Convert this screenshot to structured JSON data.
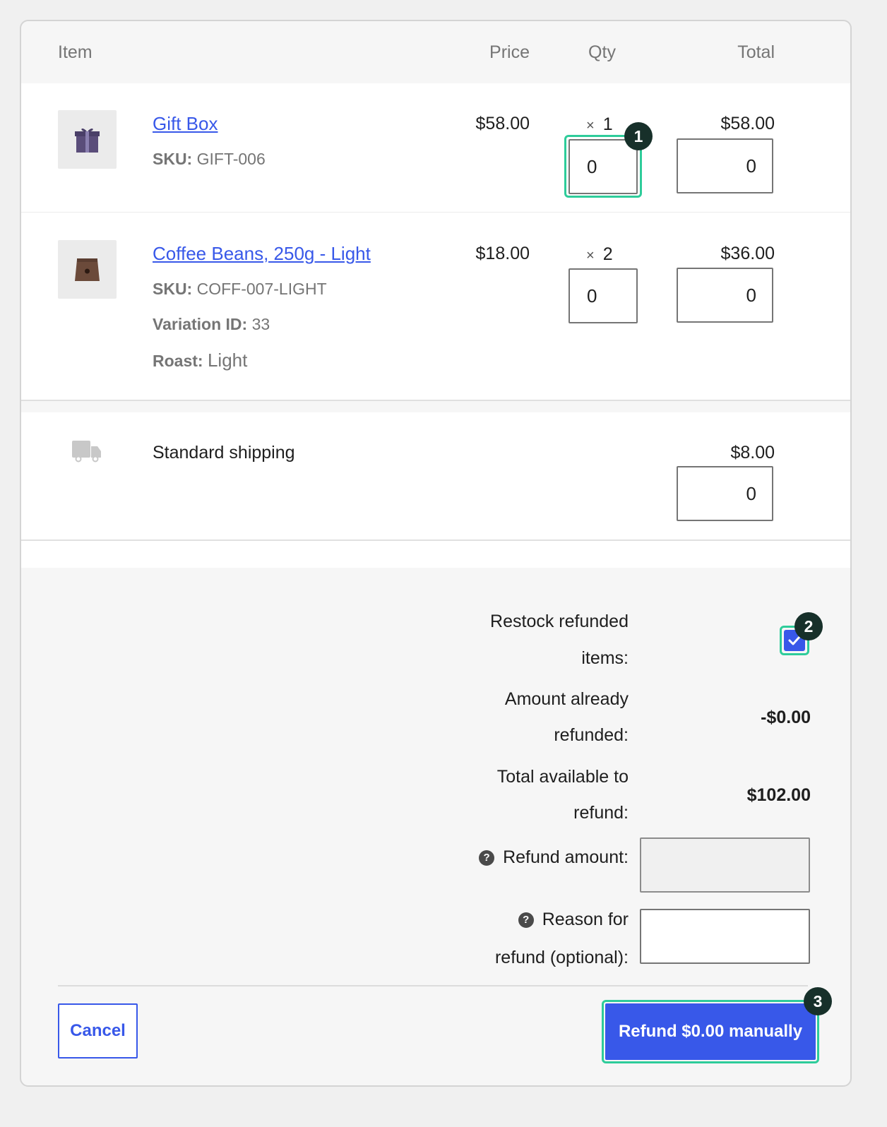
{
  "table": {
    "headers": {
      "item": "Item",
      "price": "Price",
      "qty": "Qty",
      "total": "Total"
    }
  },
  "items": [
    {
      "name": "Gift Box",
      "sku_label": "SKU:",
      "sku": "GIFT-006",
      "price": "$58.00",
      "qty_mult": "×",
      "qty": "1",
      "total": "$58.00",
      "refund_qty": "0",
      "refund_total": "0",
      "thumb_icon": "gift-box-icon"
    },
    {
      "name": "Coffee Beans, 250g - Light",
      "sku_label": "SKU:",
      "sku": "COFF-007-LIGHT",
      "variation_label": "Variation ID:",
      "variation": "33",
      "roast_label": "Roast:",
      "roast": "Light",
      "price": "$18.00",
      "qty_mult": "×",
      "qty": "2",
      "total": "$36.00",
      "refund_qty": "0",
      "refund_total": "0",
      "thumb_icon": "coffee-bag-icon"
    }
  ],
  "shipping": {
    "icon": "truck-icon",
    "label": "Standard shipping",
    "total": "$8.00",
    "refund_total": "0"
  },
  "refund": {
    "restock_label_1": "Restock refunded",
    "restock_label_2": "items:",
    "restock_checked": true,
    "already_label_1": "Amount already",
    "already_label_2": "refunded:",
    "already_value": "-$0.00",
    "available_label_1": "Total available to",
    "available_label_2": "refund:",
    "available_value": "$102.00",
    "amount_label": "Refund amount:",
    "amount_value": "",
    "reason_label_1": "Reason for",
    "reason_label_2": "refund (optional):",
    "reason_value": "",
    "help_glyph": "?"
  },
  "actions": {
    "cancel": "Cancel",
    "refund": "Refund $0.00 manually"
  },
  "badges": [
    "1",
    "2",
    "3"
  ],
  "colors": {
    "accent": "#3858e9",
    "highlight": "#2ecc9a",
    "badge": "#17302a"
  }
}
